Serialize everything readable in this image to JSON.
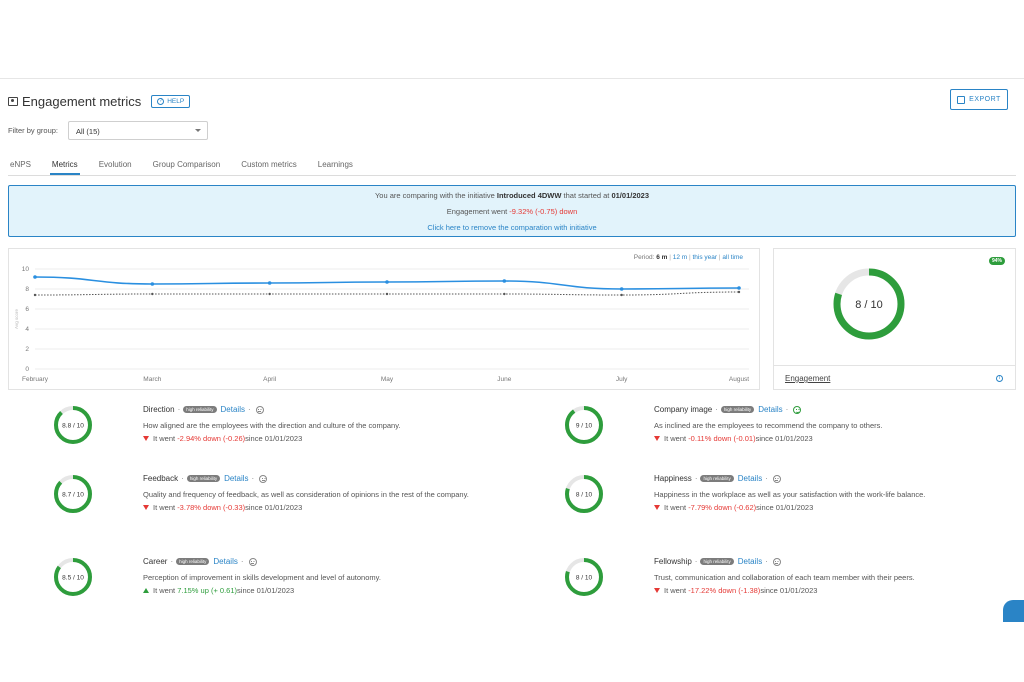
{
  "header": {
    "title": "Engagement metrics",
    "help_label": "HELP",
    "export_label": "EXPORT"
  },
  "filter": {
    "label": "Filter by group:",
    "value": "All (15)"
  },
  "tabs": [
    {
      "label": "eNPS"
    },
    {
      "label": "Metrics",
      "active": true
    },
    {
      "label": "Evolution"
    },
    {
      "label": "Group Comparison"
    },
    {
      "label": "Custom metrics"
    },
    {
      "label": "Learnings"
    }
  ],
  "banner": {
    "line1_a": "You are comparing with the initiative ",
    "initiative": "Introduced 4DWW",
    "line1_b": " that started at ",
    "start_date": "01/01/2023",
    "line2_a": "Engagement went ",
    "line2_change": "-9.32% (-0.75) down",
    "line3": "Click here to remove the comparation with initiative"
  },
  "period": {
    "label": "Period:",
    "current": "6 m",
    "options": [
      "12 m",
      "this year",
      "all time"
    ]
  },
  "chart_data": {
    "type": "line",
    "x": [
      "February",
      "March",
      "April",
      "May",
      "June",
      "July",
      "August"
    ],
    "ylim": [
      0,
      10
    ],
    "yticks": [
      0,
      2,
      4,
      6,
      8,
      10
    ],
    "ylabel": "Avg score",
    "series": [
      {
        "values": [
          9.2,
          8.5,
          8.6,
          8.7,
          8.8,
          8.0,
          8.1
        ],
        "color": "#2a8fe0",
        "style": "solid"
      },
      {
        "values": [
          7.4,
          7.5,
          7.5,
          7.5,
          7.5,
          7.4,
          7.7
        ],
        "color": "#555555",
        "style": "dotted"
      }
    ]
  },
  "engagement": {
    "badge": "94%",
    "score_text": "8 / 10",
    "score": 8,
    "max": 10,
    "label": "Engagement"
  },
  "metrics": [
    {
      "name": "Direction",
      "reliability": "high reliability",
      "details": "Details",
      "mood": "neutral",
      "score_text": "8.8 / 10",
      "score": 8.8,
      "description": "How aligned are the employees with the direction and culture of the company.",
      "trend_dir": "down",
      "trend_prefix": "It went ",
      "trend_change": "-2.94% down (-0.26)",
      "trend_suffix": " since 01/01/2023"
    },
    {
      "name": "Company image",
      "reliability": "high reliability",
      "details": "Details",
      "mood": "happy",
      "score_text": "9 / 10",
      "score": 9,
      "description": "As inclined are the employees to recommend the company to others.",
      "trend_dir": "down",
      "trend_prefix": "It went ",
      "trend_change": "-0.11% down (-0.01)",
      "trend_suffix": " since 01/01/2023"
    },
    {
      "name": "Feedback",
      "reliability": "high reliability",
      "details": "Details",
      "mood": "neutral",
      "score_text": "8.7 / 10",
      "score": 8.7,
      "description": "Quality and frequency of feedback, as well as consideration of opinions in the rest of the company.",
      "trend_dir": "down",
      "trend_prefix": "It went ",
      "trend_change": "-3.78% down (-0.33)",
      "trend_suffix": " since 01/01/2023"
    },
    {
      "name": "Happiness",
      "reliability": "high reliability",
      "details": "Details",
      "mood": "neutral",
      "score_text": "8 / 10",
      "score": 8,
      "description": "Happiness in the workplace as well as your satisfaction with the work-life balance.",
      "trend_dir": "down",
      "trend_prefix": "It went ",
      "trend_change": "-7.79% down (-0.62)",
      "trend_suffix": " since 01/01/2023"
    },
    {
      "name": "Career",
      "reliability": "high reliability",
      "details": "Details",
      "mood": "neutral",
      "score_text": "8.5 / 10",
      "score": 8.5,
      "description": "Perception of improvement in skills development and level of autonomy.",
      "trend_dir": "up",
      "trend_prefix": "It went ",
      "trend_change": "7.15% up (+ 0.61)",
      "trend_suffix": " since 01/01/2023"
    },
    {
      "name": "Fellowship",
      "reliability": "high reliability",
      "details": "Details",
      "mood": "neutral",
      "score_text": "8 / 10",
      "score": 8,
      "description": "Trust, communication and collaboration of each team member with their peers.",
      "trend_dir": "down",
      "trend_prefix": "It went ",
      "trend_change": "-17.22% down (-1.38)",
      "trend_suffix": " since 01/01/2023"
    }
  ],
  "colors": {
    "accent": "#2a84c6",
    "ring_green": "#2e9d3c",
    "ring_track": "#e6e6e6",
    "down": "#e53935",
    "up": "#2e9d3c",
    "banner_bg": "#e2f3fb"
  }
}
